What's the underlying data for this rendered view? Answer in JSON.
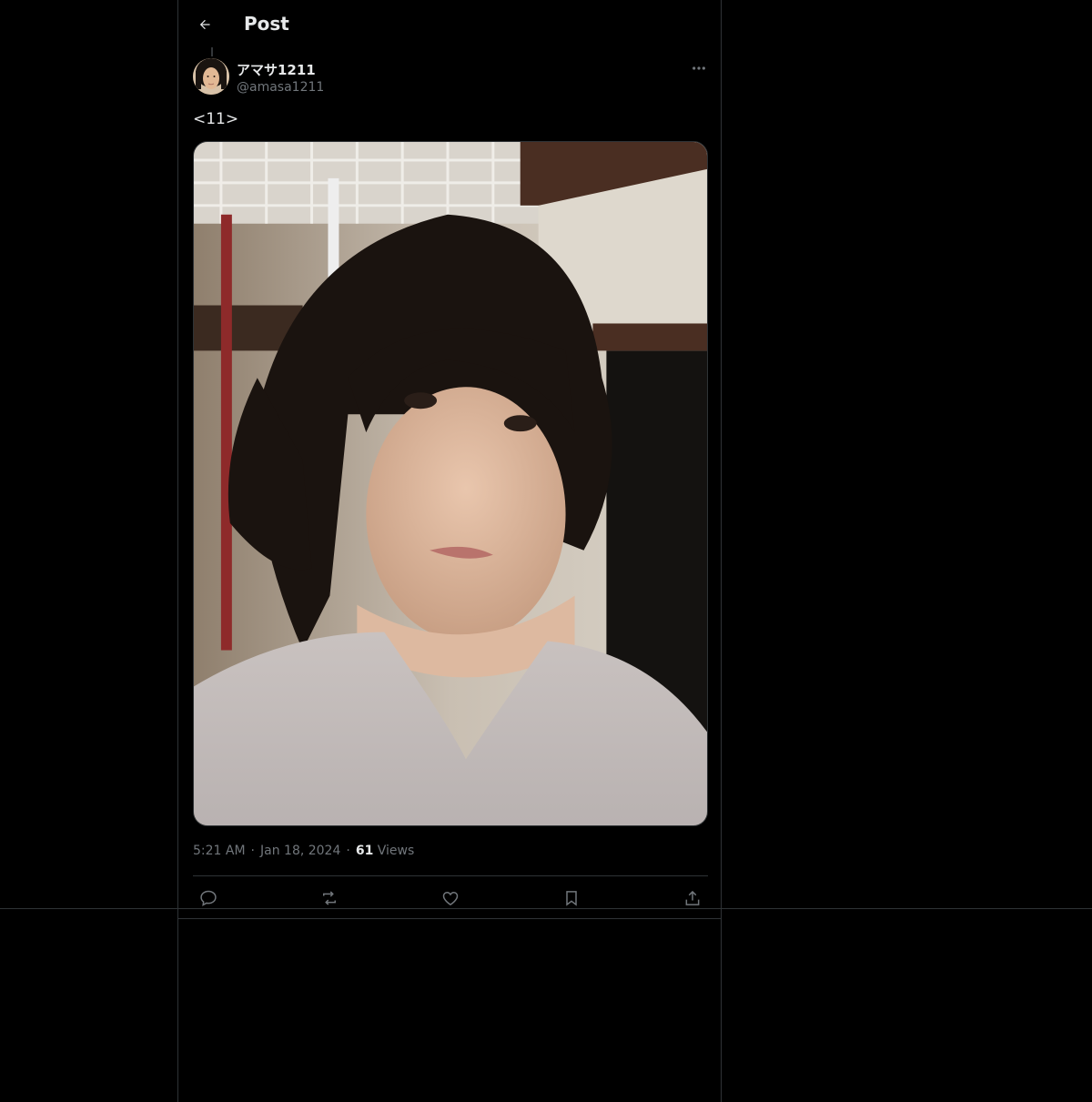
{
  "header": {
    "title": "Post"
  },
  "post": {
    "display_name": "アマサ1211",
    "handle": "@amasa1211",
    "text": "<11>",
    "time": "5:21 AM",
    "separator": "·",
    "date": "Jan 18, 2024",
    "views_count": "61",
    "views_label": "Views"
  },
  "icons": {
    "back": "arrow-left-icon",
    "more": "more-horizontal-icon",
    "reply": "reply-icon",
    "repost": "repost-icon",
    "like": "heart-icon",
    "bookmark": "bookmark-icon",
    "share": "share-icon"
  },
  "colors": {
    "background": "#000000",
    "text_primary": "#e7e9ea",
    "text_secondary": "#71767b",
    "border": "#2f3336"
  }
}
